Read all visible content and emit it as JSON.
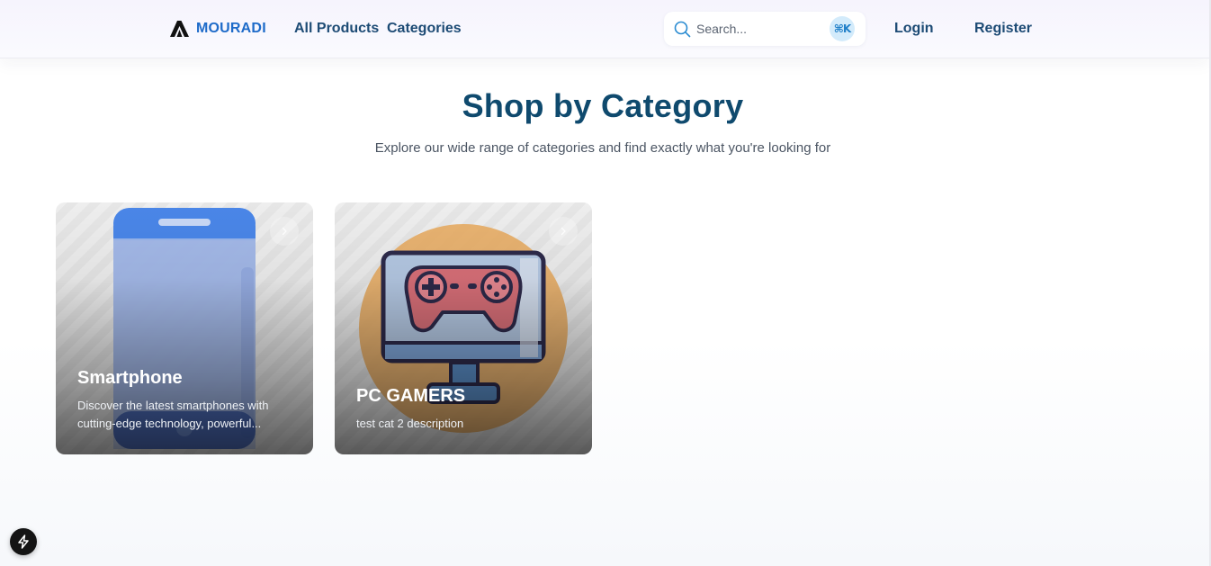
{
  "header": {
    "brand": "MOURADI",
    "nav": [
      {
        "label": "All Products"
      },
      {
        "label": "Categories"
      }
    ],
    "search": {
      "placeholder": "Search...",
      "shortcut": "⌘K"
    },
    "auth": {
      "login": "Login",
      "register": "Register"
    }
  },
  "section": {
    "title": "Shop by Category",
    "subtitle": "Explore our wide range of categories and find exactly what you're looking for"
  },
  "categories": [
    {
      "title": "Smartphone",
      "description_lines": [
        "Discover the latest smartphones with",
        "cutting-edge technology, powerful..."
      ],
      "art_icon": "smartphone-illustration"
    },
    {
      "title": "PC GAMERS",
      "description_lines": [
        "test cat 2 description"
      ],
      "art_icon": "gaming-monitor-illustration"
    }
  ],
  "colors": {
    "brand": "#1e6bc9",
    "nav_text": "#1d4b75",
    "title": "#0f4a6e",
    "kbd_bg": "#d3ebfb"
  }
}
